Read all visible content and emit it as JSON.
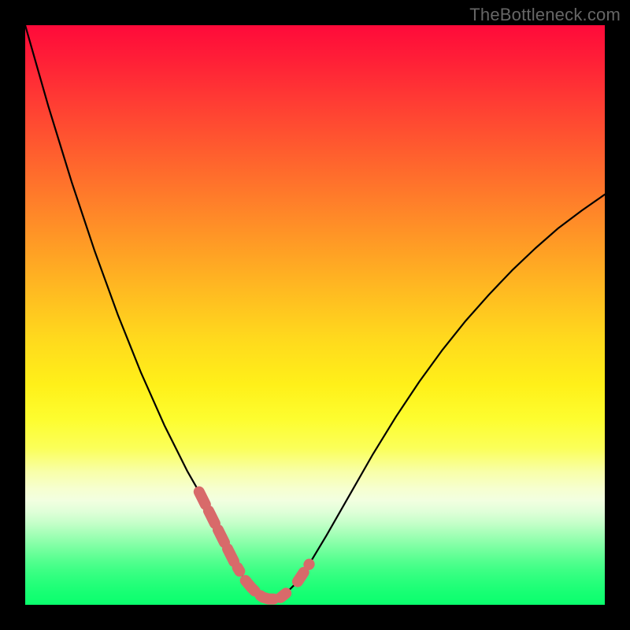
{
  "watermark": "TheBottleneck.com",
  "colors": {
    "background": "#000000",
    "curve_stroke": "#000000",
    "highlight_stroke": "#d86a6a",
    "gradient_top": "#ff0a3a",
    "gradient_bottom": "#0aff6d"
  },
  "chart_data": {
    "type": "line",
    "title": "",
    "xlabel": "",
    "ylabel": "",
    "xlim": [
      0,
      100
    ],
    "ylim": [
      0,
      100
    ],
    "grid": false,
    "legend": false,
    "annotations": [],
    "x": [
      0,
      2,
      4,
      6,
      8,
      10,
      12,
      14,
      16,
      18,
      20,
      22,
      24,
      26,
      28,
      30,
      32,
      33,
      34,
      35,
      36,
      37,
      38,
      39,
      40,
      41,
      42,
      43,
      44,
      45,
      47,
      49,
      52,
      56,
      60,
      64,
      68,
      72,
      76,
      80,
      84,
      88,
      92,
      96,
      100
    ],
    "values": [
      100,
      93,
      86,
      79.5,
      73,
      67,
      61,
      55.5,
      50,
      45,
      40,
      35.5,
      31,
      27,
      23,
      19.5,
      15.5,
      13.5,
      11.5,
      9.5,
      7.5,
      5.8,
      4.2,
      3,
      2,
      1.3,
      1,
      1,
      1.2,
      2,
      4,
      7,
      12,
      19,
      26,
      32.5,
      38.5,
      44,
      49,
      53.5,
      57.7,
      61.5,
      65,
      68,
      70.8
    ],
    "highlight_ranges": [
      {
        "x_start": 30,
        "x_end": 37
      },
      {
        "x_start": 38,
        "x_end": 46
      },
      {
        "x_start": 47,
        "x_end": 50
      }
    ]
  }
}
